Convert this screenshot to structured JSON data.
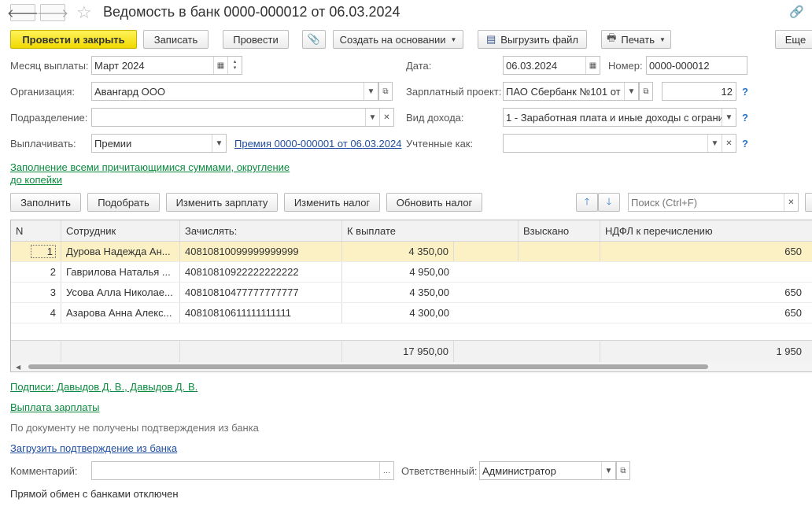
{
  "title": "Ведомость в банк 0000-000012 от 06.03.2024",
  "nav": {
    "back": "🡐",
    "forward": "🡒"
  },
  "toolbar": {
    "post_close": "Провести и закрыть",
    "save": "Записать",
    "post": "Провести",
    "create_based": "Создать на основании",
    "export_file": "Выгрузить файл",
    "print": "Печать",
    "more": "Еще"
  },
  "form": {
    "month_label": "Месяц выплаты:",
    "month_value": "Март 2024",
    "date_label": "Дата:",
    "date_value": "06.03.2024",
    "number_label": "Номер:",
    "number_value": "0000-000012",
    "org_label": "Организация:",
    "org_value": "Авангард ООО",
    "salary_project_label": "Зарплатный проект:",
    "salary_project_value": "ПАО Сбербанк №101 от",
    "salary_project_num": "12",
    "division_label": "Подразделение:",
    "division_value": "",
    "income_type_label": "Вид дохода:",
    "income_type_value": "1 - Заработная плата и иные доходы с ограни",
    "pay_label": "Выплачивать:",
    "pay_value": "Премии",
    "bonus_link": "Премия 0000-000001 от 06.03.2024",
    "counted_label": "Учтенные как:",
    "counted_value": "",
    "fill_link_line1": "Заполнение всеми причитающимися суммами, округление",
    "fill_link_line2": "до копейки",
    "help": "?"
  },
  "table_toolbar": {
    "fill": "Заполнить",
    "pick": "Подобрать",
    "change_salary": "Изменить зарплату",
    "change_tax": "Изменить налог",
    "update_tax": "Обновить налог",
    "search_placeholder": "Поиск (Ctrl+F)"
  },
  "table": {
    "columns": [
      "N",
      "Сотрудник",
      "Зачислять:",
      "К выплате",
      "Взыскано",
      "НДФЛ к перечислению"
    ],
    "rows": [
      {
        "n": "1",
        "employee": "Дурова Надежда Ан...",
        "account": "40810810099999999999",
        "payout": "4 350,00",
        "withheld": "",
        "ndfl": "650"
      },
      {
        "n": "2",
        "employee": "Гаврилова Наталья ...",
        "account": "40810810922222222222",
        "payout": "4 950,00",
        "withheld": "",
        "ndfl": ""
      },
      {
        "n": "3",
        "employee": "Усова Алла Николае...",
        "account": "40810810477777777777",
        "payout": "4 350,00",
        "withheld": "",
        "ndfl": "650"
      },
      {
        "n": "4",
        "employee": "Азарова Анна Алекс...",
        "account": "40810810611111111111",
        "payout": "4 300,00",
        "withheld": "",
        "ndfl": "650"
      }
    ],
    "totals": {
      "payout": "17 950,00",
      "ndfl": "1 950"
    }
  },
  "footer": {
    "signatures_link": "Подписи: Давыдов Д. В., Давыдов Д. В.",
    "salary_payment_link": "Выплата зарплаты",
    "bank_status": "По документу не получены подтверждения из банка",
    "load_confirmation_link": "Загрузить подтверждение из банка",
    "comment_label": "Комментарий:",
    "comment_value": "",
    "responsible_label": "Ответственный:",
    "responsible_value": "Администратор",
    "exchange_status": "Прямой обмен с банками отключен"
  }
}
